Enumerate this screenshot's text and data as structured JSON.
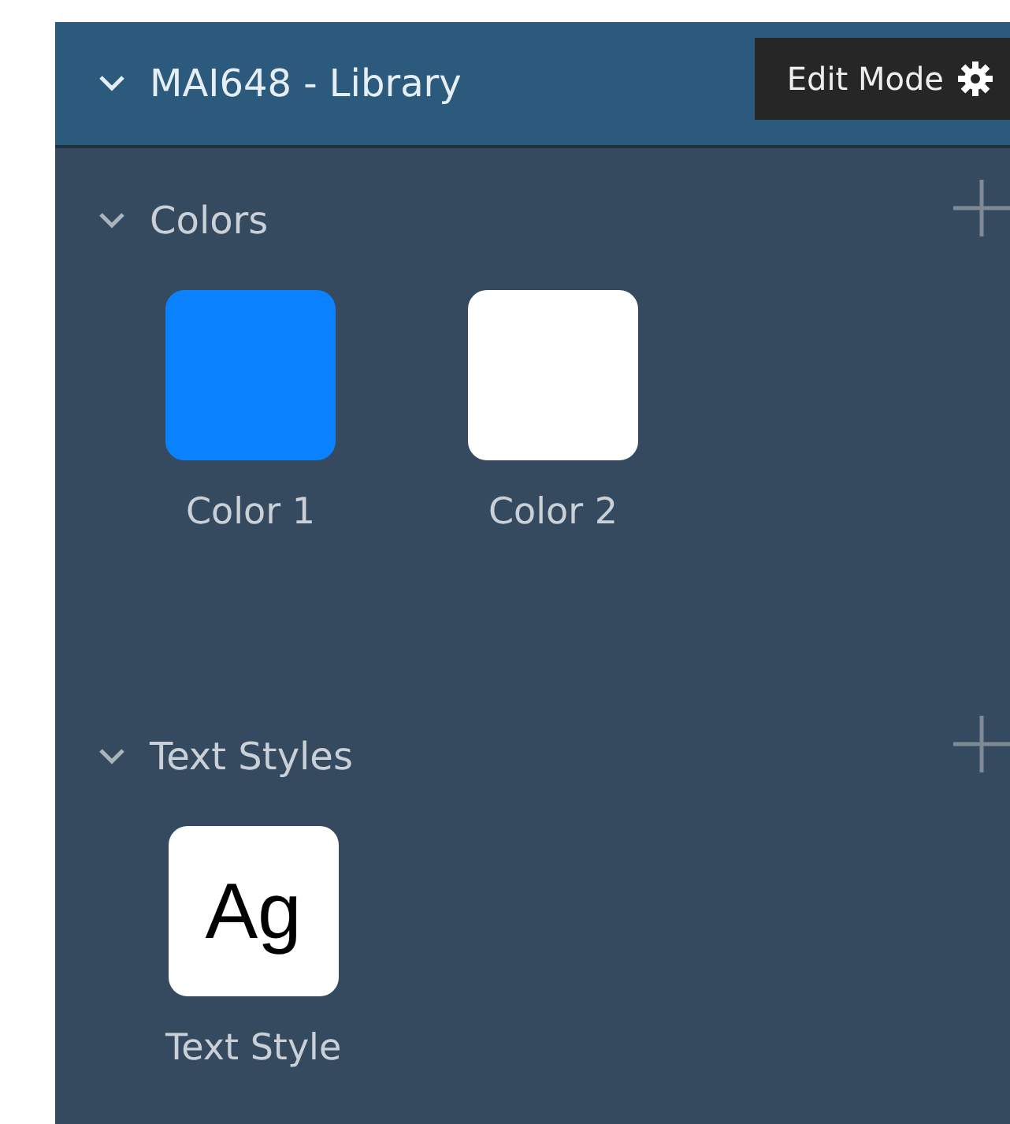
{
  "header": {
    "title": "MAI648 - Library",
    "expanded": true,
    "edit_mode_button": "Edit Mode"
  },
  "sections": [
    {
      "title": "Colors",
      "expanded": true,
      "items": [
        {
          "kind": "color",
          "label": "Color 1",
          "color": "#0a82fd"
        },
        {
          "kind": "color",
          "label": "Color 2",
          "color": "#ffffff"
        }
      ]
    },
    {
      "title": "Text Styles",
      "expanded": true,
      "items": [
        {
          "kind": "text-style",
          "label": "Text Style",
          "preview": "Ag"
        }
      ]
    }
  ]
}
